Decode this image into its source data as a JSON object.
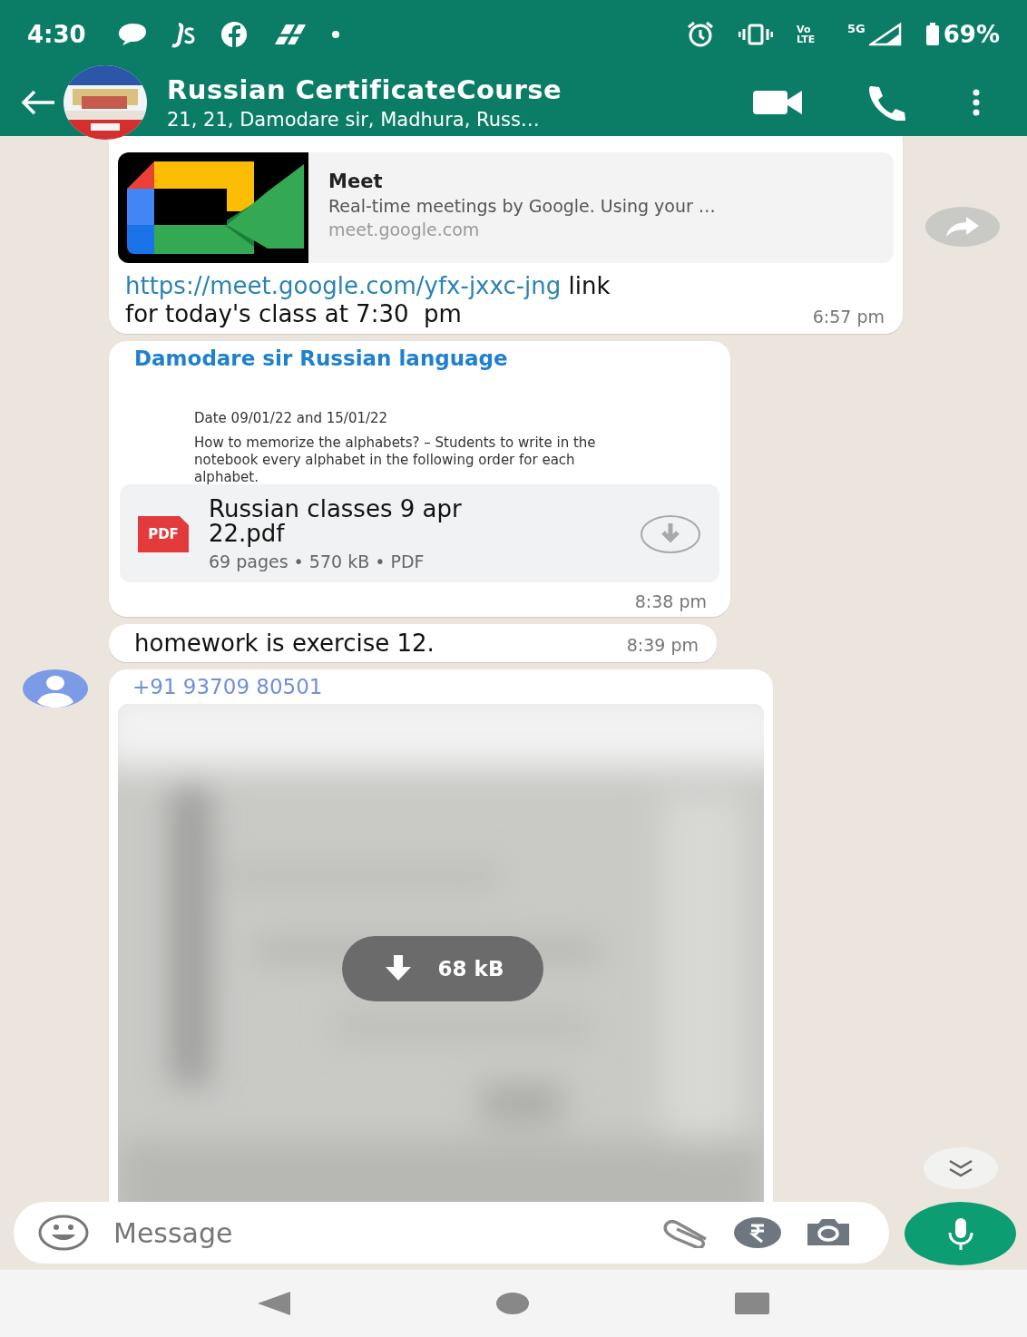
{
  "status_bar": {
    "time": "4:30",
    "volte": "Vo LTE",
    "network": "5G",
    "battery": "69%"
  },
  "header": {
    "title": "Russian CertificateCourse",
    "subtitle": "21, 21, Damodare sir, Madhura, Russ…"
  },
  "messages": [
    {
      "kind": "link",
      "preview": {
        "title": "Meet",
        "description": "Real-time meetings by Google. Using your …",
        "domain": "meet.google.com"
      },
      "link": "https://meet.google.com/yfx-jxxc-jng",
      "text": " link for today's class at 7:30  pm",
      "time": "6:57 pm"
    },
    {
      "kind": "document",
      "sender": "Damodare sir Russian language",
      "preview_lines": [
        "Date 09/01/22 and 15/01/22",
        "How to memorize the alphabets? – Students to write in the notebook every alphabet in the following order for each alphabet."
      ],
      "file_type": "PDF",
      "file_name": "Russian classes 9 apr 22.pdf",
      "file_meta": "69 pages • 570 kB • PDF",
      "time": "8:38 pm"
    },
    {
      "kind": "text",
      "text": "homework is exercise 12.",
      "time": "8:39 pm"
    },
    {
      "sender": "+91 93709 80501",
      "download_size": "68 kB"
    }
  ],
  "composer": {
    "placeholder": "Message"
  }
}
